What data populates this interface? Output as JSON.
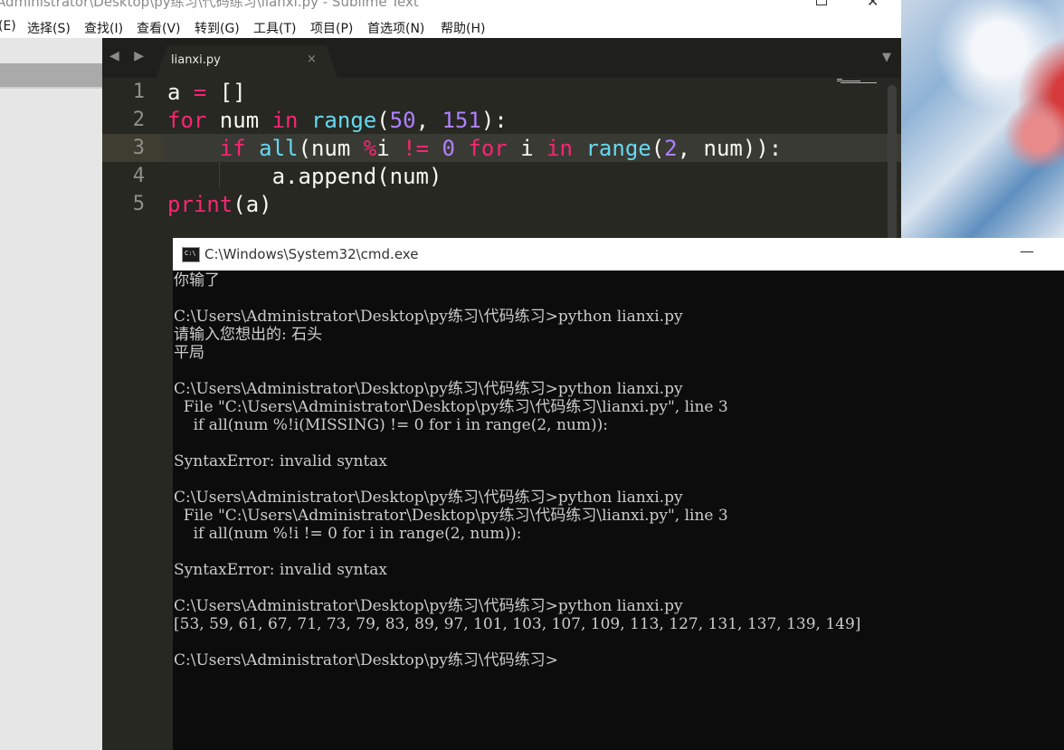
{
  "sublime": {
    "window_title": "Administrator\\Desktop\\py练习\\代码练习\\lianxi.py - Sublime Text",
    "menu": [
      "(E)",
      "选择(S)",
      "查找(I)",
      "查看(V)",
      "转到(G)",
      "工具(T)",
      "项目(P)",
      "首选项(N)",
      "帮助(H)"
    ],
    "tab": {
      "label": "lianxi.py",
      "close": "×"
    },
    "nav_arrows": "◀ ▶",
    "dropdown": "▼",
    "line_numbers": [
      "1",
      "2",
      "3",
      "4",
      "5"
    ],
    "code": [
      "a = []",
      "for num in range(50, 151):",
      "    if all(num %i != 0 for i in range(2, num)):",
      "        a.append(num)",
      "print(a)"
    ]
  },
  "cmd": {
    "title": "C:\\Windows\\System32\\cmd.exe",
    "minimize": "—",
    "icon_text": "C:\\",
    "lines": [
      "你输了",
      "",
      "C:\\Users\\Administrator\\Desktop\\py练习\\代码练习>python lianxi.py",
      "请输入您想出的: 石头",
      "平局",
      "",
      "C:\\Users\\Administrator\\Desktop\\py练习\\代码练习>python lianxi.py",
      "  File \"C:\\Users\\Administrator\\Desktop\\py练习\\代码练习\\lianxi.py\", line 3",
      "    if all(num %!i(MISSING) != 0 for i in range(2, num)):",
      "",
      "SyntaxError: invalid syntax",
      "",
      "C:\\Users\\Administrator\\Desktop\\py练习\\代码练习>python lianxi.py",
      "  File \"C:\\Users\\Administrator\\Desktop\\py练习\\代码练习\\lianxi.py\", line 3",
      "    if all(num %!i != 0 for i in range(2, num)):",
      "",
      "SyntaxError: invalid syntax",
      "",
      "C:\\Users\\Administrator\\Desktop\\py练习\\代码练习>python lianxi.py",
      "[53, 59, 61, 67, 71, 73, 79, 83, 89, 97, 101, 103, 107, 109, 113, 127, 131, 137, 139, 149]",
      "",
      "C:\\Users\\Administrator\\Desktop\\py练习\\代码练习>"
    ]
  },
  "colors": {
    "editor_bg": "#272822",
    "keyword": "#f92672",
    "builtin": "#66d9ef",
    "number": "#ae81ff",
    "cmd_bg": "#0c0c0c",
    "cmd_text": "#cccccc"
  }
}
